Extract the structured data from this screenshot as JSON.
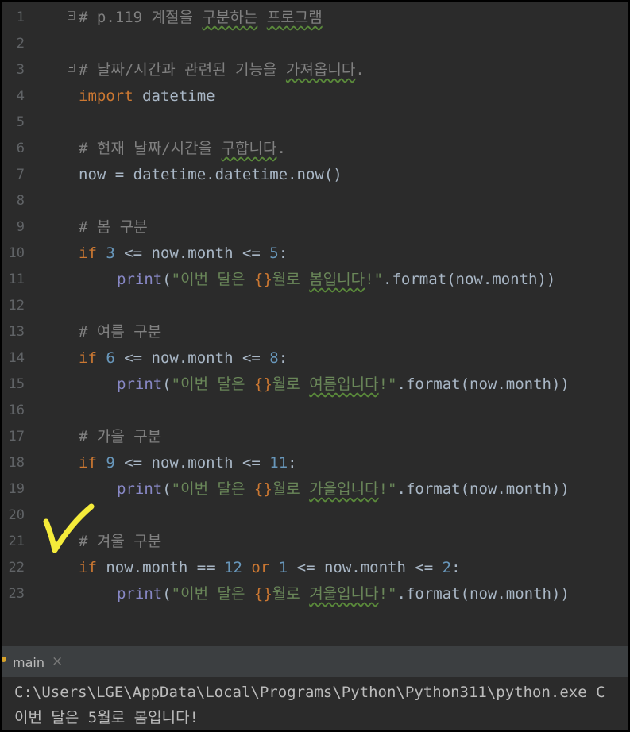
{
  "editor": {
    "lines": [
      {
        "n": "1",
        "indent": false,
        "tokens": [
          {
            "t": "# p.119 계절을 ",
            "c": "com"
          },
          {
            "t": "구분하는",
            "c": "com",
            "w": true
          },
          {
            "t": " ",
            "c": "com"
          },
          {
            "t": "프로그램",
            "c": "com",
            "w": true
          }
        ]
      },
      {
        "n": "2",
        "indent": false,
        "tokens": []
      },
      {
        "n": "3",
        "indent": false,
        "tokens": [
          {
            "t": "# 날짜/시간과 관련된 기능을 ",
            "c": "com"
          },
          {
            "t": "가져옵니다",
            "c": "com",
            "w": true
          },
          {
            "t": ".",
            "c": "com"
          }
        ]
      },
      {
        "n": "4",
        "indent": false,
        "tokens": [
          {
            "t": "import",
            "c": "kw"
          },
          {
            "t": " datetime",
            "c": "pl"
          }
        ]
      },
      {
        "n": "5",
        "indent": false,
        "tokens": []
      },
      {
        "n": "6",
        "indent": false,
        "tokens": [
          {
            "t": "# 현재 날짜/시간을 ",
            "c": "com"
          },
          {
            "t": "구합니다",
            "c": "com",
            "w": true
          },
          {
            "t": ".",
            "c": "com"
          }
        ]
      },
      {
        "n": "7",
        "indent": false,
        "tokens": [
          {
            "t": "now = datetime.datetime.now()",
            "c": "pl"
          }
        ]
      },
      {
        "n": "8",
        "indent": false,
        "tokens": []
      },
      {
        "n": "9",
        "indent": false,
        "tokens": [
          {
            "t": "# 봄 구분",
            "c": "com"
          }
        ]
      },
      {
        "n": "10",
        "indent": false,
        "tokens": [
          {
            "t": "if",
            "c": "kw"
          },
          {
            "t": " ",
            "c": "pl"
          },
          {
            "t": "3",
            "c": "num"
          },
          {
            "t": " <= now.month <= ",
            "c": "pl"
          },
          {
            "t": "5",
            "c": "num"
          },
          {
            "t": ":",
            "c": "pl"
          }
        ]
      },
      {
        "n": "11",
        "indent": true,
        "tokens": [
          {
            "t": "print",
            "c": "bi"
          },
          {
            "t": "(",
            "c": "pl"
          },
          {
            "t": "\"이번 달은 ",
            "c": "str"
          },
          {
            "t": "{}",
            "c": "ph"
          },
          {
            "t": "월로 ",
            "c": "str"
          },
          {
            "t": "봄입니다",
            "c": "str",
            "w": true
          },
          {
            "t": "!\"",
            "c": "str"
          },
          {
            "t": ".format(now.month))",
            "c": "pl"
          }
        ]
      },
      {
        "n": "12",
        "indent": false,
        "tokens": []
      },
      {
        "n": "13",
        "indent": false,
        "tokens": [
          {
            "t": "# 여름 구분",
            "c": "com"
          }
        ]
      },
      {
        "n": "14",
        "indent": false,
        "tokens": [
          {
            "t": "if",
            "c": "kw"
          },
          {
            "t": " ",
            "c": "pl"
          },
          {
            "t": "6",
            "c": "num"
          },
          {
            "t": " <= now.month <= ",
            "c": "pl"
          },
          {
            "t": "8",
            "c": "num"
          },
          {
            "t": ":",
            "c": "pl"
          }
        ]
      },
      {
        "n": "15",
        "indent": true,
        "tokens": [
          {
            "t": "print",
            "c": "bi"
          },
          {
            "t": "(",
            "c": "pl"
          },
          {
            "t": "\"이번 달은 ",
            "c": "str"
          },
          {
            "t": "{}",
            "c": "ph"
          },
          {
            "t": "월로 ",
            "c": "str"
          },
          {
            "t": "여름입니다",
            "c": "str",
            "w": true
          },
          {
            "t": "!\"",
            "c": "str"
          },
          {
            "t": ".format(now.month))",
            "c": "pl"
          }
        ]
      },
      {
        "n": "16",
        "indent": false,
        "tokens": []
      },
      {
        "n": "17",
        "indent": false,
        "tokens": [
          {
            "t": "# 가을 구분",
            "c": "com"
          }
        ]
      },
      {
        "n": "18",
        "indent": false,
        "tokens": [
          {
            "t": "if",
            "c": "kw"
          },
          {
            "t": " ",
            "c": "pl"
          },
          {
            "t": "9",
            "c": "num"
          },
          {
            "t": " <= now.month <= ",
            "c": "pl"
          },
          {
            "t": "11",
            "c": "num"
          },
          {
            "t": ":",
            "c": "pl"
          }
        ]
      },
      {
        "n": "19",
        "indent": true,
        "tokens": [
          {
            "t": "print",
            "c": "bi"
          },
          {
            "t": "(",
            "c": "pl"
          },
          {
            "t": "\"이번 달은 ",
            "c": "str"
          },
          {
            "t": "{}",
            "c": "ph"
          },
          {
            "t": "월로 ",
            "c": "str"
          },
          {
            "t": "가을입니다",
            "c": "str",
            "w": true
          },
          {
            "t": "!\"",
            "c": "str"
          },
          {
            "t": ".format(now.month))",
            "c": "pl"
          }
        ]
      },
      {
        "n": "20",
        "indent": false,
        "tokens": []
      },
      {
        "n": "21",
        "indent": false,
        "tokens": [
          {
            "t": "# 겨울 구분",
            "c": "com"
          }
        ]
      },
      {
        "n": "22",
        "indent": false,
        "tokens": [
          {
            "t": "if",
            "c": "kw"
          },
          {
            "t": " now.month == ",
            "c": "pl"
          },
          {
            "t": "12",
            "c": "num"
          },
          {
            "t": " ",
            "c": "pl"
          },
          {
            "t": "or",
            "c": "kw"
          },
          {
            "t": " ",
            "c": "pl"
          },
          {
            "t": "1",
            "c": "num"
          },
          {
            "t": " <= now.month <= ",
            "c": "pl"
          },
          {
            "t": "2",
            "c": "num"
          },
          {
            "t": ":",
            "c": "pl"
          }
        ]
      },
      {
        "n": "23",
        "indent": true,
        "tokens": [
          {
            "t": "print",
            "c": "bi"
          },
          {
            "t": "(",
            "c": "pl"
          },
          {
            "t": "\"이번 달은 ",
            "c": "str"
          },
          {
            "t": "{}",
            "c": "ph"
          },
          {
            "t": "월로 ",
            "c": "str"
          },
          {
            "t": "겨울입니다",
            "c": "str",
            "w": true
          },
          {
            "t": "!\"",
            "c": "str"
          },
          {
            "t": ".format(now.month))",
            "c": "pl"
          }
        ]
      }
    ]
  },
  "run_panel": {
    "tab_label": "main",
    "close_icon": "×",
    "console_lines": [
      "C:\\Users\\LGE\\AppData\\Local\\Programs\\Python\\Python311\\python.exe C",
      "이번 달은 5월로 봄입니다!"
    ]
  },
  "colors": {
    "editor_bg": "#2b2b2b",
    "comment": "#808080",
    "keyword": "#cc7832",
    "number": "#6897bb",
    "string": "#6a8759",
    "builtin": "#8888c6",
    "annotation": "#f5ec3a"
  },
  "icons": [
    "fold-marker-icon",
    "checkmark-annotation-icon",
    "run-config-dot-icon",
    "close-icon"
  ]
}
